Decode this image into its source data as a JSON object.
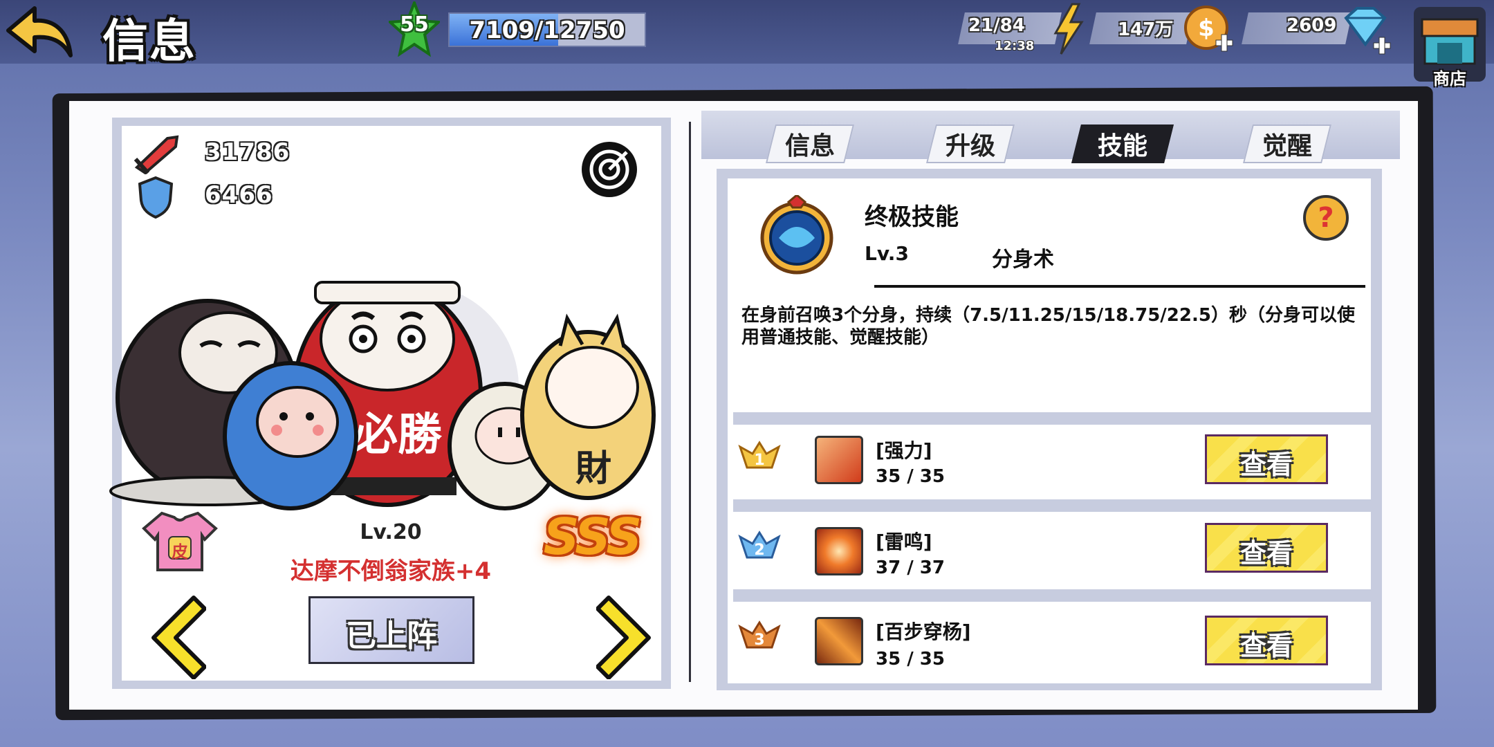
{
  "header": {
    "title": "信息",
    "level": "55",
    "exp_text": "7109/12750",
    "exp_fraction": 0.557,
    "stamina": "21/84",
    "stamina_timer": "12:38",
    "gold": "147万",
    "diamonds": "2609",
    "shop_label": "商店"
  },
  "hero": {
    "attack": "31786",
    "defense": "6466",
    "level": "Lv.20",
    "name": "达摩不倒翁家族+4",
    "rank": "SSS",
    "skin_label": "皮",
    "deploy_label": "已上阵"
  },
  "tabs": [
    {
      "label": "信息",
      "active": false
    },
    {
      "label": "升级",
      "active": false
    },
    {
      "label": "技能",
      "active": true
    },
    {
      "label": "觉醒",
      "active": false
    }
  ],
  "ultimate": {
    "title": "终极技能",
    "level": "Lv.3",
    "name": "分身术",
    "help": "?",
    "description": "在身前召唤3个分身，持续（7.5/11.25/15/18.75/22.5）秒（分身可以使用普通技能、觉醒技能）"
  },
  "skills": [
    {
      "rank": "1",
      "name": "[强力]",
      "value": "35 / 35",
      "button": "查看"
    },
    {
      "rank": "2",
      "name": "[雷鸣]",
      "value": "37 / 37",
      "button": "查看"
    },
    {
      "rank": "3",
      "name": "[百步穿杨]",
      "value": "35 / 35",
      "button": "查看"
    }
  ],
  "colors": {
    "accent_yellow": "#f9e04a",
    "hero_name_red": "#d43030",
    "exp_blue": "#3b72d8"
  }
}
